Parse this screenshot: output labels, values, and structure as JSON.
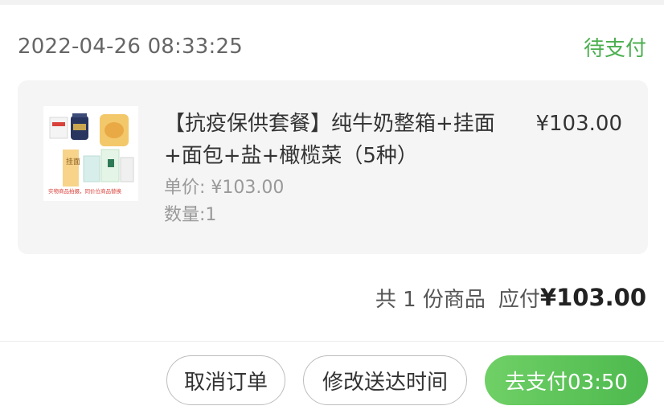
{
  "order": {
    "time": "2022-04-26 08:33:25",
    "status": "待支付",
    "status_color": "#4caf50"
  },
  "product": {
    "name": "【抗疫保供套餐】纯牛奶整箱+挂面+面包+盐+橄榄菜（5种）",
    "price": "¥103.00",
    "unit_price": "单价: ¥103.00",
    "quantity": "数量:1",
    "thumb_caption": "实物商品拍摄，同价位商品替换",
    "thumb_label": "挂面"
  },
  "summary": {
    "count_text": "共 1 份商品",
    "total_label": "应付",
    "total_value": "¥103.00"
  },
  "actions": {
    "cancel_label": "取消订单",
    "modify_label": "修改送达时间",
    "pay_label": "去支付03:50",
    "pay_color": "#4db94e"
  }
}
